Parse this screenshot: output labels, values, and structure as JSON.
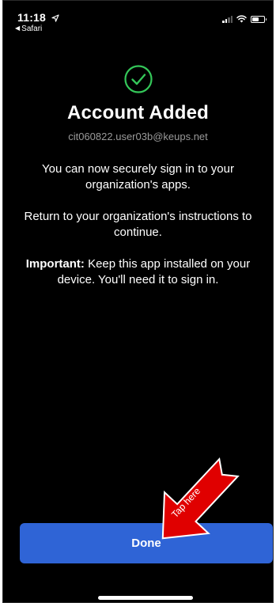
{
  "status_bar": {
    "time": "11:18",
    "back_app": "Safari",
    "battery_level": 0.6
  },
  "main": {
    "title": "Account Added",
    "email": "cit060822.user03b@keups.net",
    "para1": "You can now securely sign in to your organization's apps.",
    "para2": "Return to your organization's instructions to continue.",
    "para3_bold": "Important:",
    "para3_rest": " Keep this app installed on your device. You'll need it to sign in."
  },
  "annotation": {
    "label": "Tap here",
    "color": "#e00000"
  },
  "done_button": {
    "label": "Done",
    "color": "#2f64d6"
  },
  "icons": {
    "success": "check-circle-icon",
    "location": "location-arrow-icon",
    "back": "back-triangle-icon",
    "signal": "cellular-signal-icon",
    "wifi": "wifi-icon",
    "battery": "battery-icon"
  },
  "colors": {
    "background": "#000000",
    "success_green": "#34c759",
    "secondary_text": "#9a9a9a"
  }
}
